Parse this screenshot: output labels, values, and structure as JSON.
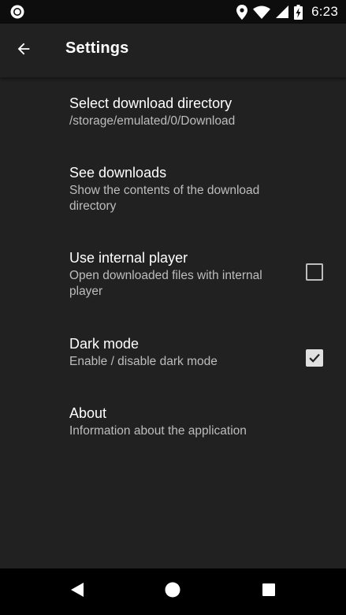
{
  "status_bar": {
    "time": "6:23",
    "left_icon": "circle-notification-icon",
    "right_icons": [
      "location-icon",
      "wifi-icon",
      "cell-signal-icon",
      "battery-charging-icon"
    ]
  },
  "app_bar": {
    "back_icon": "arrow-back-icon",
    "title": "Settings"
  },
  "settings": [
    {
      "title": "Select download directory",
      "summary": "/storage/emulated/0/Download"
    },
    {
      "title": "See downloads",
      "summary": "Show the contents of the download directory"
    },
    {
      "title": "Use internal player",
      "summary": "Open downloaded files with internal player",
      "checked": false
    },
    {
      "title": "Dark mode",
      "summary": "Enable / disable dark mode",
      "checked": true
    },
    {
      "title": "About",
      "summary": "Information about the application"
    }
  ],
  "nav_bar": {
    "icons": [
      "back-triangle-icon",
      "home-circle-icon",
      "recents-square-icon"
    ]
  },
  "colors": {
    "background": "#212121",
    "status_bar": "#0d0d0d",
    "nav_bar": "#000000",
    "primary_text": "#ffffff",
    "secondary_text": "#bdbdbd"
  }
}
